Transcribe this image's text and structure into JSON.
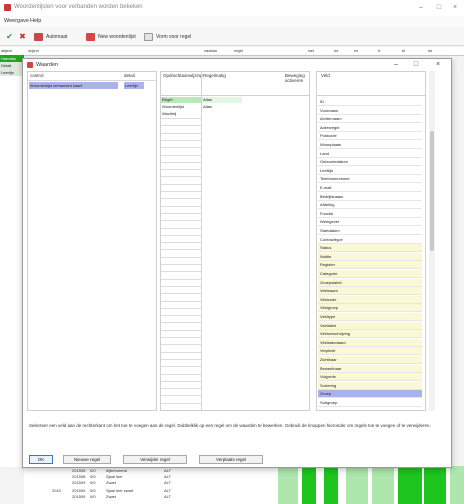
{
  "main": {
    "title": "Woordenlijsten voor verbanden worden bekeken",
    "menu": [
      "Weergave",
      "Help"
    ],
    "toolbar": {
      "action1": "Automaat",
      "action2": "New woordenlijst",
      "action3": "Vorm voor regel"
    },
    "grid_headers": [
      "object",
      "cadeau",
      "regel",
      "beschrijving",
      "rad",
      "ne",
      "ex",
      "rt",
      "el",
      "sh"
    ],
    "left_rows": [
      "object",
      "Handtas",
      "Detail",
      "Leerlijn"
    ],
    "bottom_rows": [
      [
        "201505",
        "0/0",
        "bijbehorend",
        "bijbehorend",
        "ALT"
      ],
      [
        "201508",
        "0/0",
        "Sjaal",
        "Sjaal leer",
        "ALT"
      ],
      [
        "201509",
        "0/0",
        "Zwart",
        "Zwart",
        "ALT"
      ],
      [
        "2010",
        "201509",
        "0/0",
        "Sjaal",
        "Sjaal leer zwart",
        "ALT"
      ],
      [
        "201509",
        "0/0",
        "Zwart",
        "Zwart",
        "ALT"
      ]
    ]
  },
  "dialog": {
    "title": "Waarden",
    "controls": {
      "col1": "control",
      "col2": "detail",
      "rows": [
        {
          "name": "Woordenlijst verbanden kaart",
          "value": "Leerlijn"
        }
      ]
    },
    "rules": {
      "headers": [
        "Opdrachtaanwijzing",
        "Regelmatig",
        "Beweging activeren"
      ],
      "rows": [
        [
          "Regel",
          "Atlas"
        ],
        [
          "Woordenlijst",
          "Atlas"
        ],
        [
          "Wachtrij",
          ""
        ]
      ]
    },
    "values_header": "Veld",
    "values": [
      "ID",
      "Voornaam",
      "Achternaam",
      "Adresregel",
      "Postcode",
      "Woonplaats",
      "Land",
      "Geboortedatum",
      "Leeftijd",
      "Telefoonnummer",
      "E-mail",
      "Bedrijfsnaam",
      "Afdeling",
      "Functie",
      "Werkgever",
      "Startdatum",
      "Contracttype",
      "Status",
      "Notitie",
      "Register",
      "Categorie",
      "Groepslabel",
      "Veldnaam",
      "Veldcode",
      "Veldgroep",
      "Veldtype",
      "Veldlabel",
      "Veldomschrijving",
      "Veldstandaard",
      "Verplicht",
      "Zichtbaar",
      "Bewerkbaar",
      "Volgorde",
      "Sortering",
      "Groep",
      "Subgroep"
    ],
    "info": "Selecteer een veld aan de rechterkant om het toe te voegen aan de regel. Dubbelklik op een regel om de waarden te bewerken. Gebruik de knoppen hieronder om regels toe te voegen of te verwijderen.",
    "buttons": {
      "ok": "OK",
      "add_rule": "Nieuwe regel",
      "remove_rule": "Verwijder regel",
      "move_rule": "Verplaats regel"
    }
  }
}
